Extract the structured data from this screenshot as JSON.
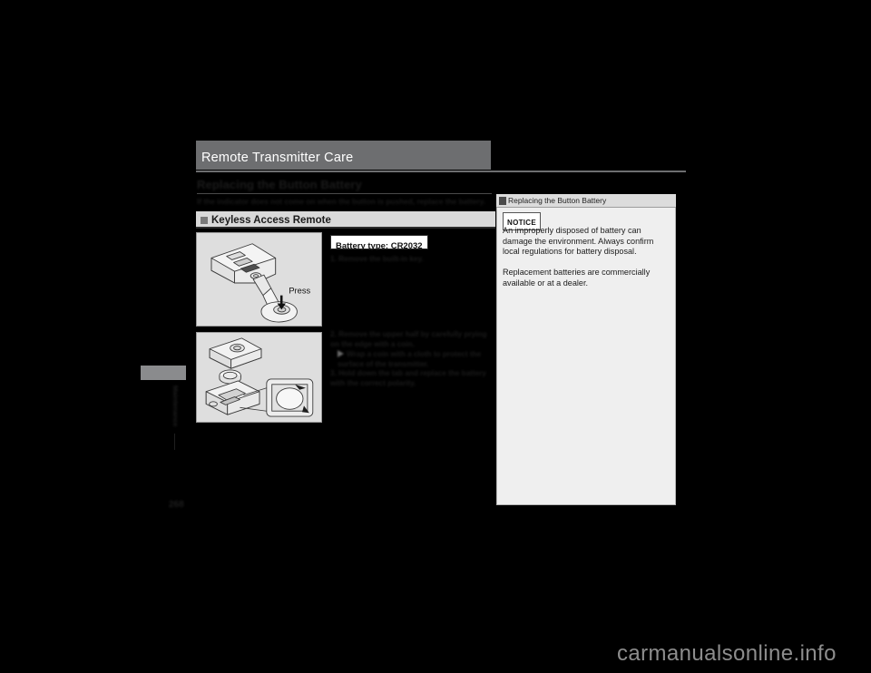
{
  "page": {
    "header_title": "Remote Transmitter Care",
    "page_number": "268",
    "chapter_vertical_label": "Maintenance",
    "watermark": "carmanualsonline.info",
    "accent_header_bar": "#6d6e70",
    "accent_subsection_bar": "#d9d9d9",
    "accent_sidebar_bg": "#efefef"
  },
  "top_boxes": {
    "left_label": "",
    "right_label": ""
  },
  "section": {
    "heading": "Replacing the Button Battery",
    "subtext": "If the indicator does not come on when the button is pushed, replace the battery.",
    "subsection_label": "Keyless Access Remote"
  },
  "callout": {
    "battery_type": "Battery type: CR2032"
  },
  "steps": [
    {
      "number": "1.",
      "text": "Remove the built-in key."
    },
    {
      "number": "2.",
      "text": "Remove the upper half by carefully prying on the edge with a coin."
    },
    {
      "number": "3.",
      "text": "Hold down the tab and replace the battery with the correct polarity."
    }
  ],
  "step_note": {
    "text": "Wrap a coin with a cloth to protect the surface of the transmitter."
  },
  "figures": {
    "key_removal": {
      "caption": "",
      "press_label": "Press"
    },
    "battery_replacement": {
      "caption": ""
    }
  },
  "info_panel": {
    "title": "Replacing the Button Battery",
    "notice_label": "NOTICE",
    "paragraph_1": "An improperly disposed of battery can damage the environment. Always confirm local regulations for battery disposal.",
    "paragraph_2": "Replacement batteries are commercially available or at a dealer."
  }
}
